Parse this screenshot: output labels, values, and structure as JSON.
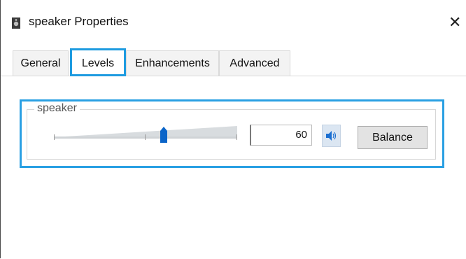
{
  "window": {
    "title": "speaker Properties",
    "close_glyph": "✕",
    "app_icon": "speaker-icon"
  },
  "tabs": [
    {
      "label": "General",
      "active": false
    },
    {
      "label": "Levels",
      "active": true
    },
    {
      "label": "Enhancements",
      "active": false
    },
    {
      "label": "Advanced",
      "active": false
    }
  ],
  "levels": {
    "group_label": "speaker",
    "slider_value": 60,
    "value_text": "60",
    "mute_icon": "speaker-volume-icon",
    "balance_label": "Balance"
  },
  "colors": {
    "highlight": "#2aa0e3",
    "thumb": "#0a64c8"
  }
}
